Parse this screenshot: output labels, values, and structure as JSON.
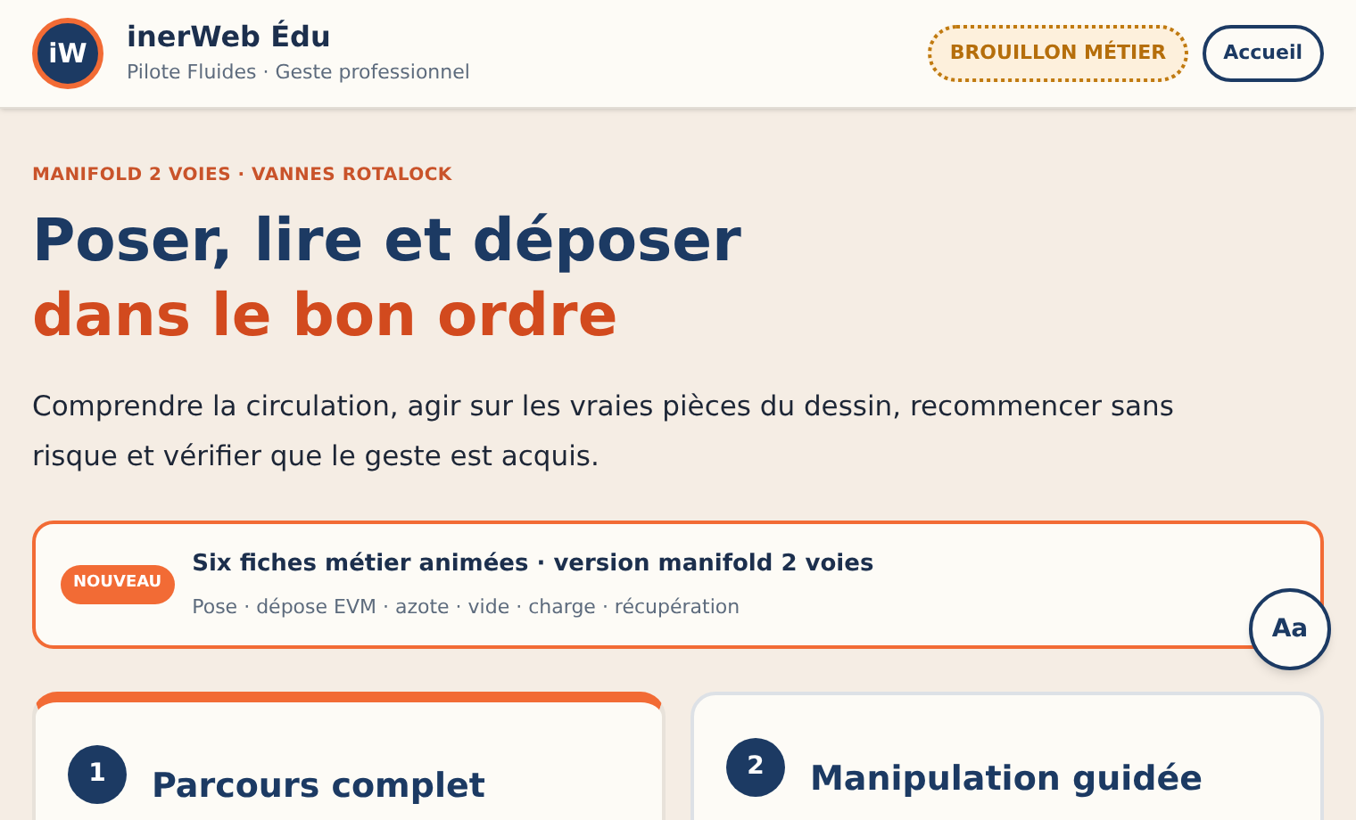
{
  "header": {
    "logo": "iW",
    "title": "inerWeb Édu",
    "subtitle": "Pilote Fluides · Geste professionnel",
    "badge": "BROUILLON MÉTIER",
    "home_button": "Accueil"
  },
  "hero": {
    "eyebrow": "MANIFOLD 2 VOIES · VANNES ROTALOCK",
    "title_line_1": "Poser, lire et déposer",
    "title_line_2": "dans le bon ordre",
    "intro": "Comprendre la circulation, agir sur les vraies pièces du dessin, recommencer sans risque et vérifier que le geste est acquis."
  },
  "notice": {
    "tag": "NOUVEAU",
    "title": "Six fiches métier animées · version manifold 2 voies",
    "details": "Pose · dépose EVM · azote · vide · charge · récupération"
  },
  "font_button": "Aa",
  "cards": [
    {
      "number": "1",
      "title": "Parcours complet",
      "highlighted": true
    },
    {
      "number": "2",
      "title": "Manipulation guidée",
      "highlighted": false
    }
  ]
}
